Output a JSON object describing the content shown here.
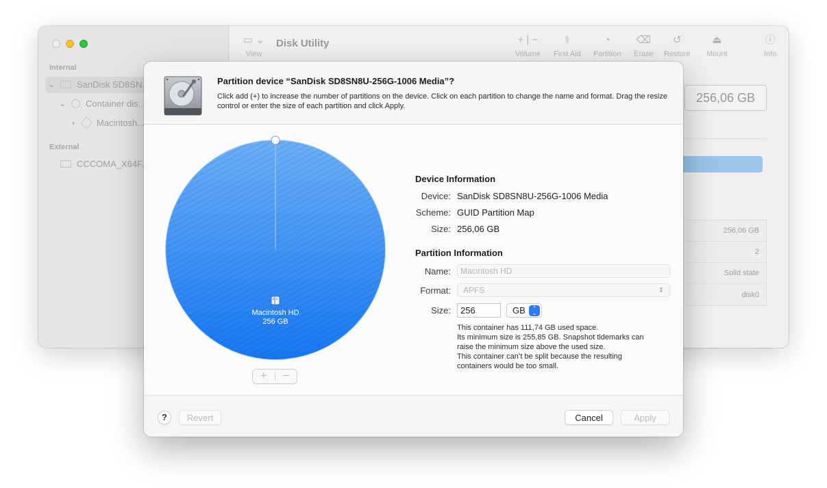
{
  "background_window": {
    "title": "Disk Utility",
    "sidebar": {
      "internal_header": "Internal",
      "external_header": "External",
      "items": [
        {
          "label": "SanDisk SD8SN..."
        },
        {
          "label": "Container dis..."
        },
        {
          "label": "Macintosh..."
        },
        {
          "label": "CCCOMA_X64F..."
        }
      ]
    },
    "toolbar": {
      "view_label": "View",
      "volume_label": "Volume",
      "first_aid_label": "First Aid",
      "partition_label": "Partition",
      "erase_label": "Erase",
      "restore_label": "Restore",
      "mount_label": "Mount",
      "info_label": "Info"
    },
    "capacity_box": "256,06 GB",
    "details": [
      "256,06 GB",
      "2",
      "Solid state",
      "disk0"
    ]
  },
  "dialog": {
    "title": "Partition device “SanDisk SD8SN8U-256G-1006 Media”?",
    "description": "Click add (+) to increase the number of partitions on the device. Click on each partition to change the name and format. Drag the resize control or enter the size of each partition and click Apply.",
    "pie": {
      "partition_name": "Macintosh HD",
      "partition_size": "256 GB",
      "share": 1.0,
      "color": "#3d8ff0",
      "add_symbol": "+",
      "remove_symbol": "−"
    },
    "device_info": {
      "heading": "Device Information",
      "device_label": "Device:",
      "device_value": "SanDisk SD8SN8U-256G-1006 Media",
      "scheme_label": "Scheme:",
      "scheme_value": "GUID Partition Map",
      "size_label": "Size:",
      "size_value": "256,06 GB"
    },
    "partition_info": {
      "heading": "Partition Information",
      "name_label": "Name:",
      "name_placeholder": "Macintosh HD",
      "format_label": "Format:",
      "format_value": "APFS",
      "size_label": "Size:",
      "size_value": "256",
      "unit_value": "GB",
      "note_lines": [
        "This container has 111,74 GB used space.",
        "Its minimum size is 255,85 GB. Snapshot tidemarks can",
        "raise the minimum size above the used size.",
        "This container can’t be split because the resulting",
        "containers would be too small."
      ]
    },
    "footer": {
      "help_symbol": "?",
      "revert_label": "Revert",
      "cancel_label": "Cancel",
      "apply_label": "Apply"
    }
  }
}
